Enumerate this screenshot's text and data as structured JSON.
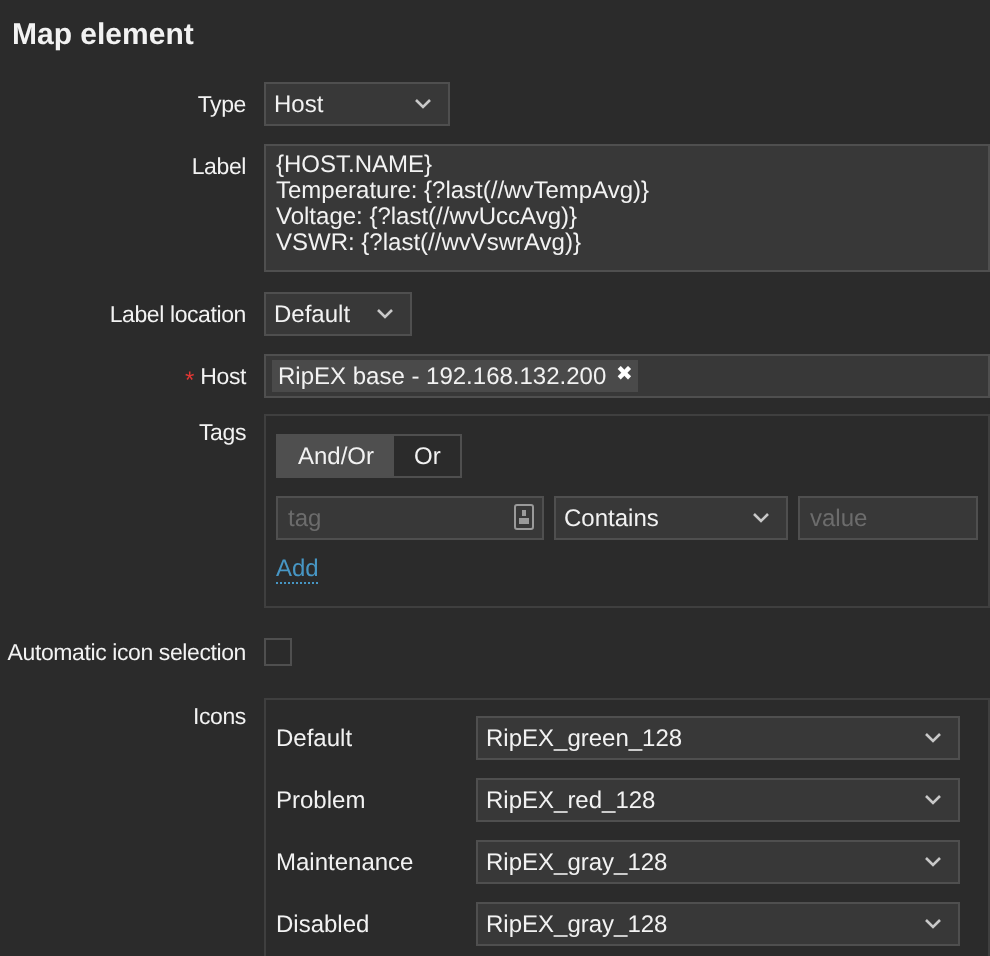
{
  "title": "Map element",
  "type": {
    "label": "Type",
    "value": "Host"
  },
  "label": {
    "label": "Label",
    "lines": [
      "{HOST.NAME}",
      "Temperature: {?last(//wvTempAvg)}",
      "Voltage: {?last(//wvUccAvg)}",
      "VSWR: {?last(//wvVswrAvg)}"
    ]
  },
  "label_location": {
    "label": "Label location",
    "value": "Default"
  },
  "host": {
    "label": "Host",
    "required": true,
    "required_mark": "*",
    "chip": "RipEX base - 192.168.132.200",
    "remove": "✖"
  },
  "tags": {
    "label": "Tags",
    "operators": [
      {
        "label": "And/Or",
        "selected": true
      },
      {
        "label": "Or",
        "selected": false
      }
    ],
    "tag_placeholder": "tag",
    "condition": "Contains",
    "value_placeholder": "value",
    "add": "Add"
  },
  "automatic_icon_selection": {
    "label": "Automatic icon selection",
    "checked": false
  },
  "icons": {
    "label": "Icons",
    "rows": [
      {
        "label": "Default",
        "value": "RipEX_green_128"
      },
      {
        "label": "Problem",
        "value": "RipEX_red_128"
      },
      {
        "label": "Maintenance",
        "value": "RipEX_gray_128"
      },
      {
        "label": "Disabled",
        "value": "RipEX_gray_128"
      }
    ]
  }
}
